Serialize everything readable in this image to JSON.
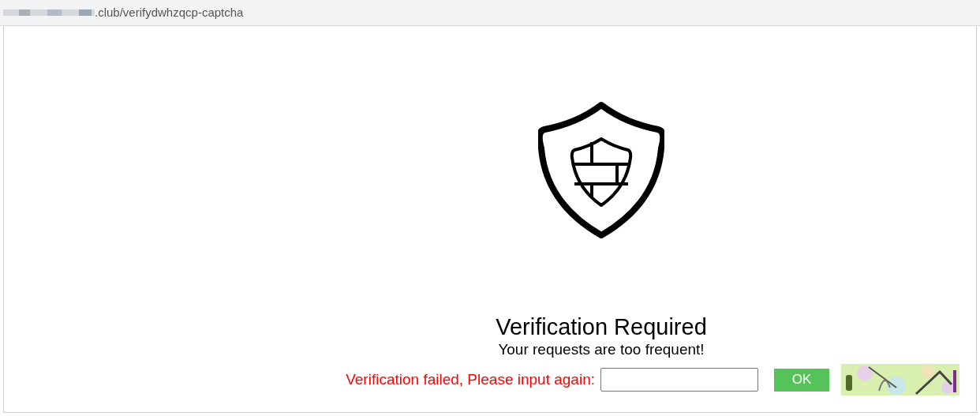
{
  "address_bar": {
    "url": ".club/verifydwhzqcp-captcha"
  },
  "heading": "Verification Required",
  "subheading": "Your requests are too frequent!",
  "form": {
    "error_label": "Verification failed, Please input again:",
    "button": "OK"
  }
}
